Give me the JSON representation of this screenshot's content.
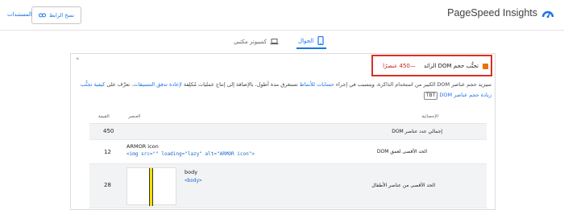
{
  "header": {
    "brand": "PageSpeed Insights",
    "docs_link": "المستندات",
    "copy_button": "نسخ الرابط"
  },
  "tabs": [
    {
      "label": "الجوال",
      "active": true
    },
    {
      "label": "كمبيوتر مكتبي",
      "active": false
    }
  ],
  "audit": {
    "title": "تجنُّب حجم DOM الزائد",
    "value": "—450 عنصرًا",
    "status_color": "#e8710a",
    "highlight_color": "#d93025",
    "description_pre": "سيزيد حجم عناصر DOM الكبير من استخدام الذاكرة، ويتسبب في إجراء ",
    "link_style_calc": "حسابات للأنماط",
    "description_mid": " تستغرق مدة أطول، بالإضافة إلى إنتاج عمليات مُكلِفة ",
    "link_reflow": "لإعادة تدفق التنسيقات",
    "description_post": ". تعرَّف على ",
    "link_learn": "كيفية تجنُّب زيادة حجم عناصر DOM",
    "tag": "TBT"
  },
  "table": {
    "headers": {
      "stat": "الإحصائية",
      "element": "العنصر",
      "value": "القيمة"
    },
    "rows": [
      {
        "stat": "إجمالي عدد عناصر DOM",
        "element_name": "",
        "element_code": "",
        "value": "450"
      },
      {
        "stat": "الحد الأقصى لعمق DOM",
        "element_name": "ARMOR icon",
        "element_code": "<img src=\"\" loading=\"lazy\" alt=\"ARMOR icon\">",
        "value": "12"
      },
      {
        "stat": "الحد الأقصى من عناصر الأطفال",
        "element_name": "body",
        "element_code": "<body>",
        "value": "28"
      }
    ]
  }
}
